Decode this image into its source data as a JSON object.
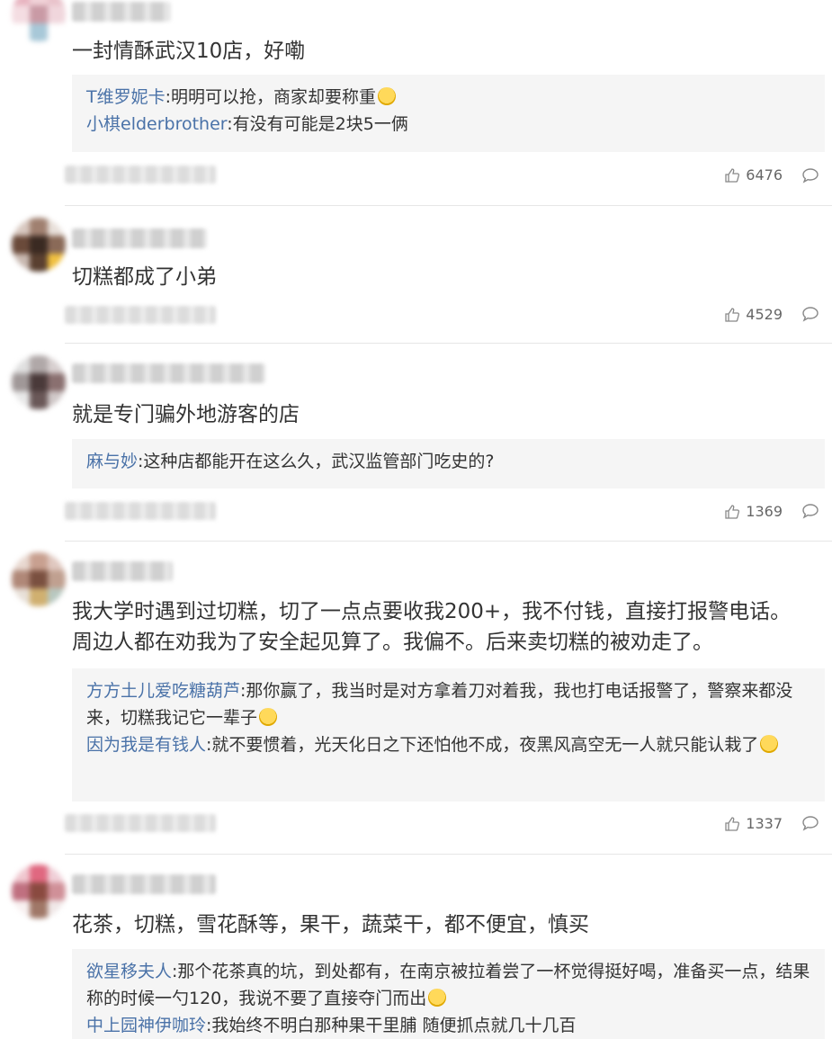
{
  "comments": [
    {
      "text": "一封情酥武汉10店，好嘞",
      "replies": [
        {
          "user": "T维罗妮卡",
          "text": ":明明可以抢，商家却要称重"
        },
        {
          "user": "小棋elderbrother",
          "text": ":有没有可能是2块5一俩"
        }
      ],
      "likes": "6476"
    },
    {
      "text": "切糕都成了小弟",
      "replies": [],
      "likes": "4529"
    },
    {
      "text": "就是专门骗外地游客的店",
      "replies": [
        {
          "user": "麻与妙",
          "text": ":这种店都能开在这么久，武汉监管部门吃史的?"
        }
      ],
      "likes": "1369"
    },
    {
      "text": "我大学时遇到过切糕，切了一点点要收我200+，我不付钱，直接打报警电话。周边人都在劝我为了安全起见算了。我偏不。后来卖切糕的被劝走了。",
      "replies": [
        {
          "user": "方方土儿爱吃糖葫芦",
          "text": ":那你赢了，我当时是对方拿着刀对着我，我也打电话报警了，警察来都没来，切糕我记它一辈子"
        },
        {
          "user": "因为我是有钱人",
          "text": ":就不要惯着，光天化日之下还怕他不成，夜黑风高空无一人就只能认栽了"
        }
      ],
      "likes": "1337"
    },
    {
      "text": "花茶，切糕，雪花酥等，果干，蔬菜干，都不便宜，慎买",
      "replies": [
        {
          "user": "欲星移夫人",
          "text": ":那个花茶真的坑，到处都有，在南京被拉着尝了一杯觉得挺好喝，准备买一点，结果称的时候一勺120，我说不要了直接夺门而出"
        },
        {
          "user": "中上园神伊咖玲",
          "text": ":我始终不明白那种果干里脯 随便抓点就几十几百"
        }
      ]
    }
  ],
  "colors": {
    "reply_user": "#4a72a8",
    "reply_bg": "#f5f5f5",
    "divider": "#e6e6e6"
  },
  "icons": {
    "like": "thumbs-up-icon",
    "reply": "comment-bubble-icon"
  }
}
